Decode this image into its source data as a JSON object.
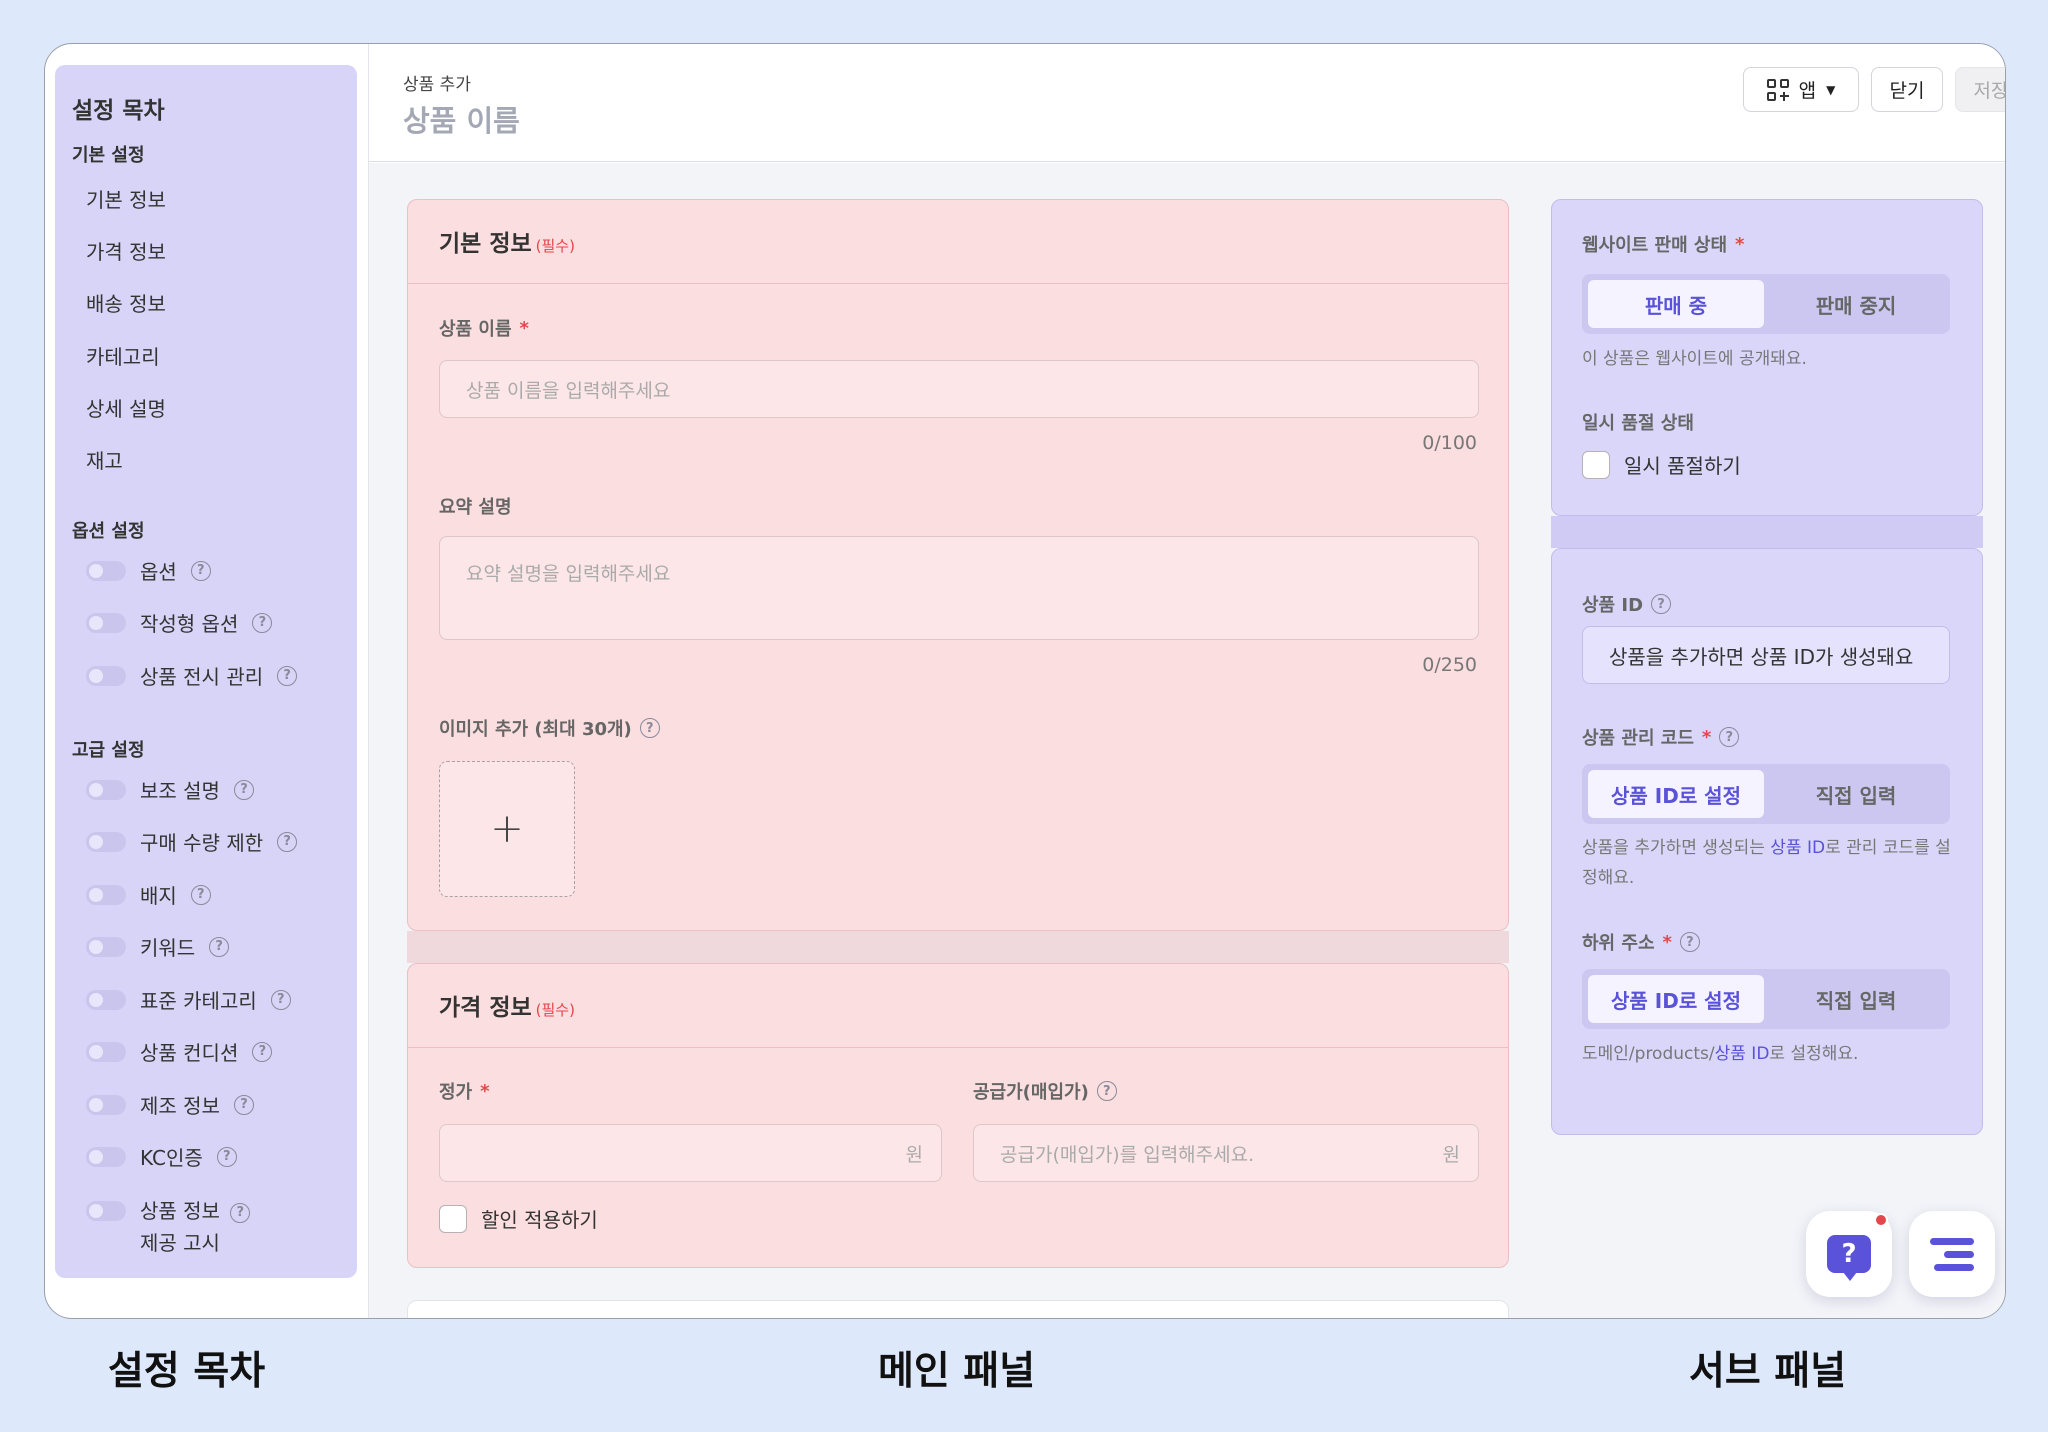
{
  "sidebar": {
    "title": "설정 목차",
    "sections": {
      "basic": "기본 설정",
      "options": "옵션 설정",
      "advanced": "고급 설정"
    },
    "basic_links": [
      "기본 정보",
      "가격 정보",
      "배송 정보",
      "카테고리",
      "상세 설명",
      "재고"
    ],
    "option_items": [
      "옵션",
      "작성형 옵션",
      "상품 전시 관리"
    ],
    "advanced_items": [
      "보조 설명",
      "구매 수량 제한",
      "배지",
      "키워드",
      "표준 카테고리",
      "상품 컨디션",
      "제조 정보",
      "KC인증",
      "상품 정보",
      "제공 고시"
    ]
  },
  "header": {
    "breadcrumb": "상품 추가",
    "title": "상품 이름",
    "app_button": "앱",
    "close_button": "닫기",
    "save_button": "저장"
  },
  "basic_info": {
    "title": "기본 정보",
    "required_tag": "(필수)",
    "name_label": "상품 이름",
    "name_placeholder": "상품 이름을 입력해주세요",
    "name_counter": "0/100",
    "summary_label": "요약 설명",
    "summary_placeholder": "요약 설명을 입력해주세요",
    "summary_counter": "0/250",
    "image_label": "이미지 추가 (최대 30개)",
    "upload_symbol": "+"
  },
  "price_info": {
    "title": "가격 정보",
    "required_tag": "(필수)",
    "list_price_label": "정가",
    "list_price_unit": "원",
    "supply_label": "공급가(매입가)",
    "supply_placeholder": "공급가(매입가)를 입력해주세요.",
    "supply_unit": "원",
    "discount_label": "할인 적용하기"
  },
  "sub_panel": {
    "sale_status_label": "웹사이트 판매 상태",
    "sale_on": "판매 중",
    "sale_off": "판매 중지",
    "sale_hint": "이 상품은 웹사이트에 공개돼요.",
    "soldout_label": "일시 품절 상태",
    "soldout_check": "일시 품절하기",
    "product_id_label": "상품 ID",
    "product_id_value": "상품을 추가하면 상품 ID가 생성돼요",
    "mgmt_code_label": "상품 관리 코드",
    "mgmt_by_id": "상품 ID로 설정",
    "mgmt_manual": "직접 입력",
    "mgmt_hint_pre": "상품을 추가하면 생성되는 ",
    "mgmt_hint_accent": "상품 ID",
    "mgmt_hint_post": "로 관리 코드를 설정해요.",
    "sub_addr_label": "하위 주소",
    "addr_by_id": "상품 ID로 설정",
    "addr_manual": "직접 입력",
    "addr_hint_pre": "도메인/products/",
    "addr_hint_accent": "상품 ID",
    "addr_hint_post": "로 설정해요."
  },
  "fab": {
    "help_symbol": "?"
  },
  "captions": {
    "toc": "설정 목차",
    "main": "메인 패널",
    "sub": "서브 패널"
  },
  "colors": {
    "accent": "#5a52d8",
    "required": "#e2474b",
    "sidebar_bg": "#d7d4f7",
    "main_card_bg": "#fbdedf",
    "sub_card_bg": "#d9d6fa",
    "page_bg": "#dde9fb"
  }
}
